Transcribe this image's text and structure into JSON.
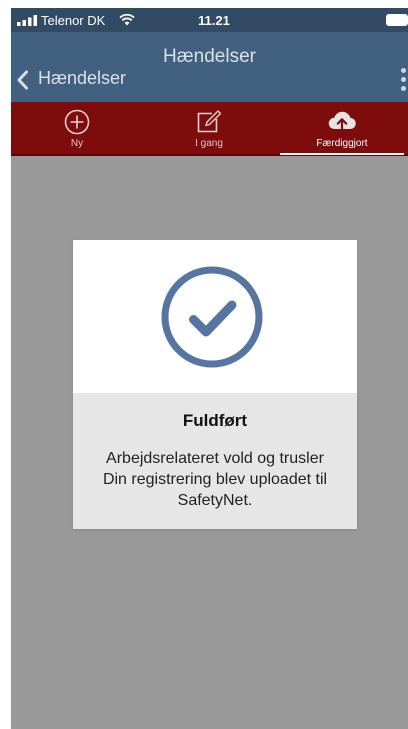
{
  "status_bar": {
    "carrier": "Telenor DK",
    "time": "11.21",
    "icons": [
      "signal-icon",
      "wifi-icon",
      "battery-icon"
    ]
  },
  "nav": {
    "title": "Hændelser",
    "back_label": "Hændelser",
    "more_icon": "more-vertical-icon"
  },
  "tabs": [
    {
      "label": "Ny",
      "icon": "add-circle-icon",
      "active": false
    },
    {
      "label": "I gang",
      "icon": "edit-icon",
      "active": false
    },
    {
      "label": "Færdiggjort",
      "icon": "cloud-upload-icon",
      "active": true
    }
  ],
  "dialog": {
    "icon": "check-circle-icon",
    "title": "Fuldført",
    "message": "Arbejdsrelateret vold og trusler Din registrering blev uploadet til SafetyNet."
  },
  "colors": {
    "status_bar": "#324a63",
    "nav_bar": "#42607f",
    "tab_bar": "#7e0c0c",
    "overlay": "#999999",
    "check_icon": "#5675a0",
    "dialog_body": "#e6e6e6"
  }
}
